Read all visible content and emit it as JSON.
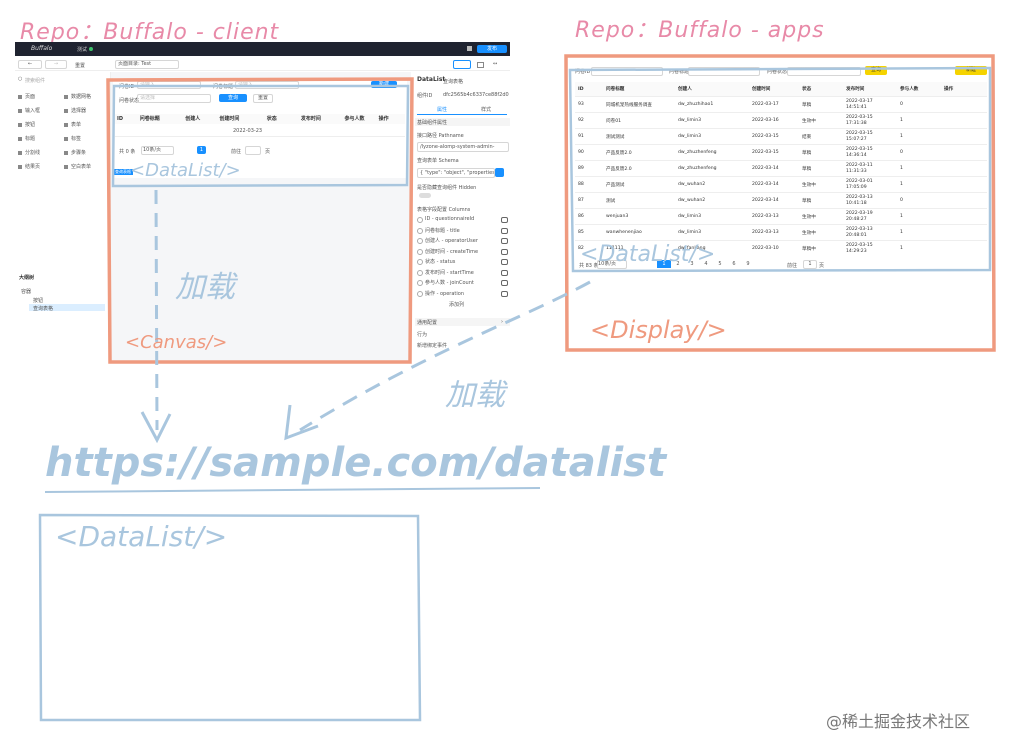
{
  "labels": {
    "repo_client": "Repo：Buffalo - client",
    "repo_apps": "Repo：Buffalo - apps",
    "datalist_tag_top": "<DataList/>",
    "canvas_tag": "<Canvas/>",
    "display_tag": "<Display/>",
    "load_left": "加载",
    "load_right": "加载",
    "url": "https://sample.com/datalist",
    "datalist_tag_bottom": "<DataList/>",
    "watermark": "@稀土掘金技术社区"
  },
  "client": {
    "topbar": {
      "brand": "Buffalo",
      "tab": "测试",
      "publish": "发布"
    },
    "toolbar": {
      "back": "←",
      "forward": "→",
      "reset": "重置",
      "breadcrumb": "页面目录: Test"
    },
    "components": {
      "search_placeholder": "搜索组件",
      "items": [
        "页面",
        "数据网格",
        "输入框",
        "选择器",
        "按钮",
        "表单",
        "标题",
        "标签",
        "分割线",
        "步骤条",
        "结果页",
        "空白表单"
      ]
    },
    "tree": {
      "header": "大纲树",
      "root": "容器",
      "children": [
        "按钮",
        "查询表格"
      ]
    },
    "canvas_area": {
      "filter_labels": [
        "问卷ID",
        "问卷标题",
        "问卷状态"
      ],
      "filter_placeholders": [
        "请输入",
        "请输入",
        "请选择"
      ],
      "search_btn": "查询",
      "reset_btn": "重置",
      "new_btn": "新建",
      "columns": [
        "ID",
        "问卷标题",
        "创建人",
        "创建时间",
        "状态",
        "发布时间",
        "参与人数",
        "操作"
      ],
      "sample_date": "2022-03-23",
      "pagination": {
        "total": "共 0 条",
        "size": "10条/页",
        "page": "1",
        "goto": "前往",
        "page_unit": "页"
      },
      "selected_badge": "查询表格"
    },
    "props_panel": {
      "title": "DataList",
      "subtitle": "查询表格",
      "id_label": "组件ID",
      "id_value": "dfc2565b4c6337ce88f2d0",
      "tabs": [
        "属性",
        "样式"
      ],
      "section_basic": "基础组件属性",
      "api_label": "接口路径 Pathname",
      "api_value": "/lyzone-alomp-system-admin-",
      "schema_label": "查询表单 Schema",
      "schema_value": "{ \"type\": \"object\", \"properties\"",
      "hidden_label": "是否隐藏查询组件 Hidden",
      "columns_label": "表格字段配置 Columns",
      "column_items": [
        "ID - questionnaireId",
        "问卷标题 - title",
        "创建人 - operatorUser",
        "创建时间 - createTime",
        "状态 - status",
        "发布时间 - startTime",
        "参与人数 - joinCount",
        "操作 - operation"
      ],
      "add_column": "添加列",
      "section_general": "通用配置",
      "section_behavior": "行为",
      "add_event": "新增绑定事件"
    }
  },
  "apps": {
    "filters": {
      "labels": [
        "问卷ID",
        "问卷标题",
        "问卷状态"
      ],
      "search_btn": "查询",
      "new_btn": "新建"
    },
    "columns": [
      "ID",
      "问卷标题",
      "创建人",
      "创建时间",
      "状态",
      "发布时间",
      "参与人数",
      "操作"
    ],
    "rows": [
      [
        "93",
        "同城机宠热线服务调查",
        "dw_zhuzhihao1",
        "2022-03-17",
        "草稿",
        "2022-03-17 14:51:41",
        "0"
      ],
      [
        "92",
        "问卷01",
        "dw_limin3",
        "2022-03-16",
        "生效中",
        "2022-03-15 17:31:38",
        "1"
      ],
      [
        "91",
        "测试测试",
        "dw_limin3",
        "2022-03-15",
        "结束",
        "2022-03-15 15:07:27",
        "1"
      ],
      [
        "90",
        "产品反馈2.0",
        "dw_zhuzhenfeng",
        "2022-03-15",
        "草稿",
        "2022-03-15 14:36:14",
        "0"
      ],
      [
        "89",
        "产品反馈2.0",
        "dw_zhuzhenfeng",
        "2022-03-14",
        "草稿",
        "2022-03-11 11:31:33",
        "1"
      ],
      [
        "88",
        "产品测试",
        "dw_wuhan2",
        "2022-03-14",
        "生效中",
        "2022-03-01 17:05:09",
        "1"
      ],
      [
        "87",
        "测试",
        "dw_wuhan2",
        "2022-03-14",
        "草稿",
        "2022-03-13 10:41:18",
        "0"
      ],
      [
        "86",
        "wenjuan3",
        "dw_limin3",
        "2022-03-13",
        "生效中",
        "2022-03-19 20:48:27",
        "1"
      ],
      [
        "85",
        "wanwhenenjiao",
        "dw_limin3",
        "2022-03-13",
        "生效中",
        "2022-03-13 20:48:01",
        "1"
      ],
      [
        "82",
        "111111",
        "dw_fanliang",
        "2022-03-10",
        "草稿中",
        "2022-03-15 14:29:23",
        "1"
      ]
    ],
    "pagination": {
      "total": "共 83 条",
      "size": "10条/页",
      "pages": [
        "1",
        "2",
        "3",
        "4",
        "5",
        "6",
        "9"
      ],
      "goto": "前往",
      "goto_value": "1",
      "page_unit": "页"
    }
  },
  "colors": {
    "pink": "#e88aa8",
    "orange": "#ef9a7f",
    "blue_sketch": "#a9c6de",
    "primary": "#1890ff",
    "yellow": "#f5d300",
    "topbar": "#1f2330"
  }
}
